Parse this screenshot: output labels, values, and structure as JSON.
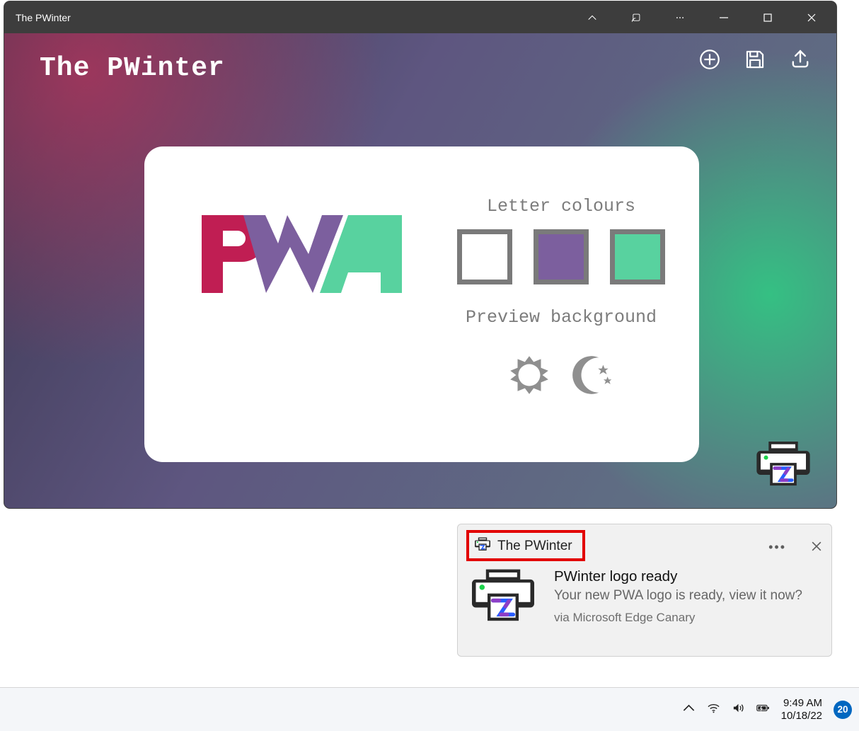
{
  "window": {
    "title": "The PWinter"
  },
  "app": {
    "title": "The PWinter",
    "toolbar": {
      "add": "add-icon",
      "save": "save-icon",
      "share": "share-icon"
    }
  },
  "card": {
    "letters_heading": "Letter colours",
    "background_heading": "Preview background",
    "colors": {
      "p": "#c01e53",
      "w": "#7c5f9e",
      "a": "#58d29f"
    }
  },
  "notification": {
    "app_name": "The PWinter",
    "title": "PWinter logo ready",
    "message": "Your new PWA logo is ready, view it now?",
    "via": "via Microsoft Edge Canary"
  },
  "taskbar": {
    "time": "9:49 AM",
    "date": "10/18/22",
    "badge": "20"
  }
}
